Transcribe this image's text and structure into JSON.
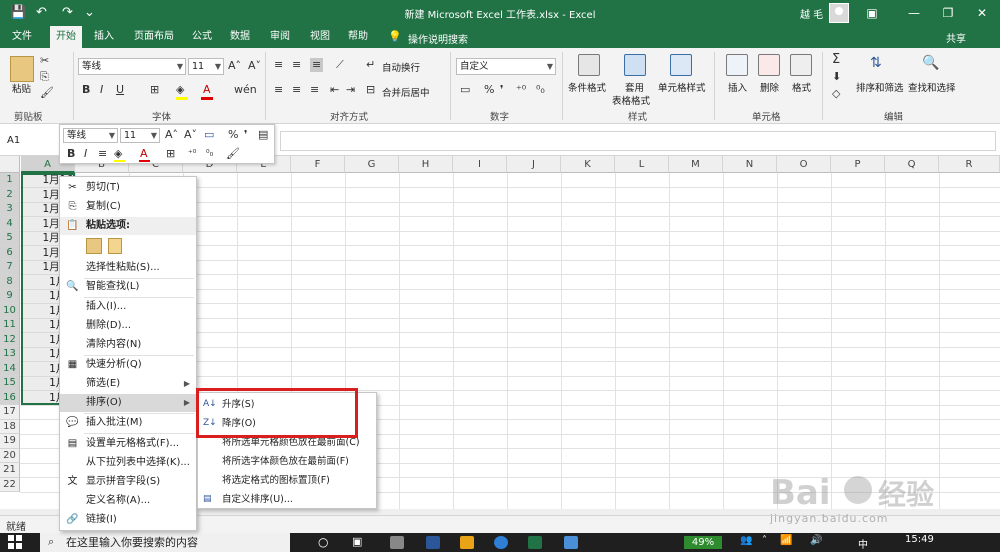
{
  "window": {
    "title": "新建 Microsoft Excel 工作表.xlsx  -  Excel",
    "user": "越 毛",
    "quick_access": {
      "save": "💾",
      "undo": "↶",
      "redo": "↷",
      "more": "⌄"
    },
    "controls": {
      "ribbon_options": "▣",
      "minimize": "—",
      "restore": "❐",
      "close": "✕"
    }
  },
  "ribbon_tabs": [
    "文件",
    "开始",
    "插入",
    "页面布局",
    "公式",
    "数据",
    "审阅",
    "视图",
    "帮助"
  ],
  "active_tab": "开始",
  "tell_me": "操作说明搜索",
  "share": "共享",
  "ribbon": {
    "clipboard": {
      "paste": "粘贴",
      "label": "剪贴板"
    },
    "font": {
      "name": "等线",
      "size": "11",
      "grow": "A˄",
      "shrink": "A˅",
      "bold": "B",
      "italic": "I",
      "underline": "U",
      "wen": "wén",
      "label": "字体"
    },
    "alignment": {
      "wrap": "自动换行",
      "merge": "合并后居中",
      "label": "对齐方式"
    },
    "number": {
      "format": "自定义",
      "percent": "%",
      "comma": "❜",
      "label": "数字"
    },
    "styles": {
      "conditional": "条件格式",
      "table_l1": "套用",
      "table_l2": "表格格式",
      "cell_styles": "单元格样式",
      "label": "样式"
    },
    "cells": {
      "insert": "插入",
      "delete": "删除",
      "format": "格式",
      "label": "单元格"
    },
    "editing": {
      "sigma": "Σ",
      "sort": "排序和筛选",
      "find": "查找和选择",
      "label": "编辑"
    }
  },
  "name_box": "A1",
  "mini_toolbar": {
    "font": "等线",
    "size": "11",
    "bold": "B",
    "italic": "I",
    "percent": "%",
    "comma": "❜"
  },
  "columns": [
    "A",
    "B",
    "C",
    "D",
    "E",
    "F",
    "G",
    "H",
    "I",
    "J",
    "K",
    "L",
    "M",
    "N",
    "O",
    "P",
    "Q",
    "R"
  ],
  "rows": [
    "1",
    "2",
    "3",
    "4",
    "5",
    "6",
    "7",
    "8",
    "9",
    "10",
    "11",
    "12",
    "13",
    "14",
    "15",
    "16",
    "17",
    "18",
    "19",
    "20",
    "21",
    "22"
  ],
  "cells_col_a": [
    "1月16",
    "1月15",
    "1月14",
    "1月13",
    "1月12",
    "1月11",
    "1月10",
    "1月9",
    "1月8",
    "1月7",
    "1月6",
    "1月5",
    "1月4",
    "1月3",
    "1月2",
    "1月1"
  ],
  "context_menu": [
    {
      "label": "剪切(T)",
      "icon": "✂"
    },
    {
      "label": "复制(C)",
      "icon": "⎘"
    },
    {
      "label": "粘贴选项:",
      "icon": "📋"
    },
    {
      "label": "",
      "icon": ""
    },
    {
      "label": "选择性粘贴(S)...",
      "icon": ""
    },
    {
      "label": "智能查找(L)",
      "icon": "🔍"
    },
    {
      "label": "插入(I)...",
      "icon": ""
    },
    {
      "label": "删除(D)...",
      "icon": ""
    },
    {
      "label": "清除内容(N)",
      "icon": ""
    },
    {
      "label": "快速分析(Q)",
      "icon": "▦"
    },
    {
      "label": "筛选(E)",
      "icon": ""
    },
    {
      "label": "排序(O)",
      "icon": ""
    },
    {
      "label": "插入批注(M)",
      "icon": "💬"
    },
    {
      "label": "设置单元格格式(F)...",
      "icon": "▤"
    },
    {
      "label": "从下拉列表中选择(K)...",
      "icon": ""
    },
    {
      "label": "显示拼音字段(S)",
      "icon": "文"
    },
    {
      "label": "定义名称(A)...",
      "icon": ""
    },
    {
      "label": "链接(I)",
      "icon": "🔗"
    }
  ],
  "submenu": [
    {
      "label": "升序(S)",
      "icon": "A↓"
    },
    {
      "label": "降序(O)",
      "icon": "Z↓"
    },
    {
      "label": "将所选单元格颜色放在最前面(C)",
      "icon": ""
    },
    {
      "label": "将所选字体颜色放在最前面(F)",
      "icon": ""
    },
    {
      "label": "将选定格式的图标置顶(F)",
      "icon": ""
    },
    {
      "label": "自定义排序(U)...",
      "icon": "▤"
    }
  ],
  "status": "就绪",
  "taskbar": {
    "search": "在这里输入你要搜索的内容",
    "battery": "49%",
    "time": "15:49",
    "ime": "中"
  },
  "watermark": {
    "logo": "Bai百度经验",
    "url": "jingyan.baidu.com"
  },
  "colors": {
    "excel_green": "#217346",
    "highlight_red": "#d91e1e"
  }
}
